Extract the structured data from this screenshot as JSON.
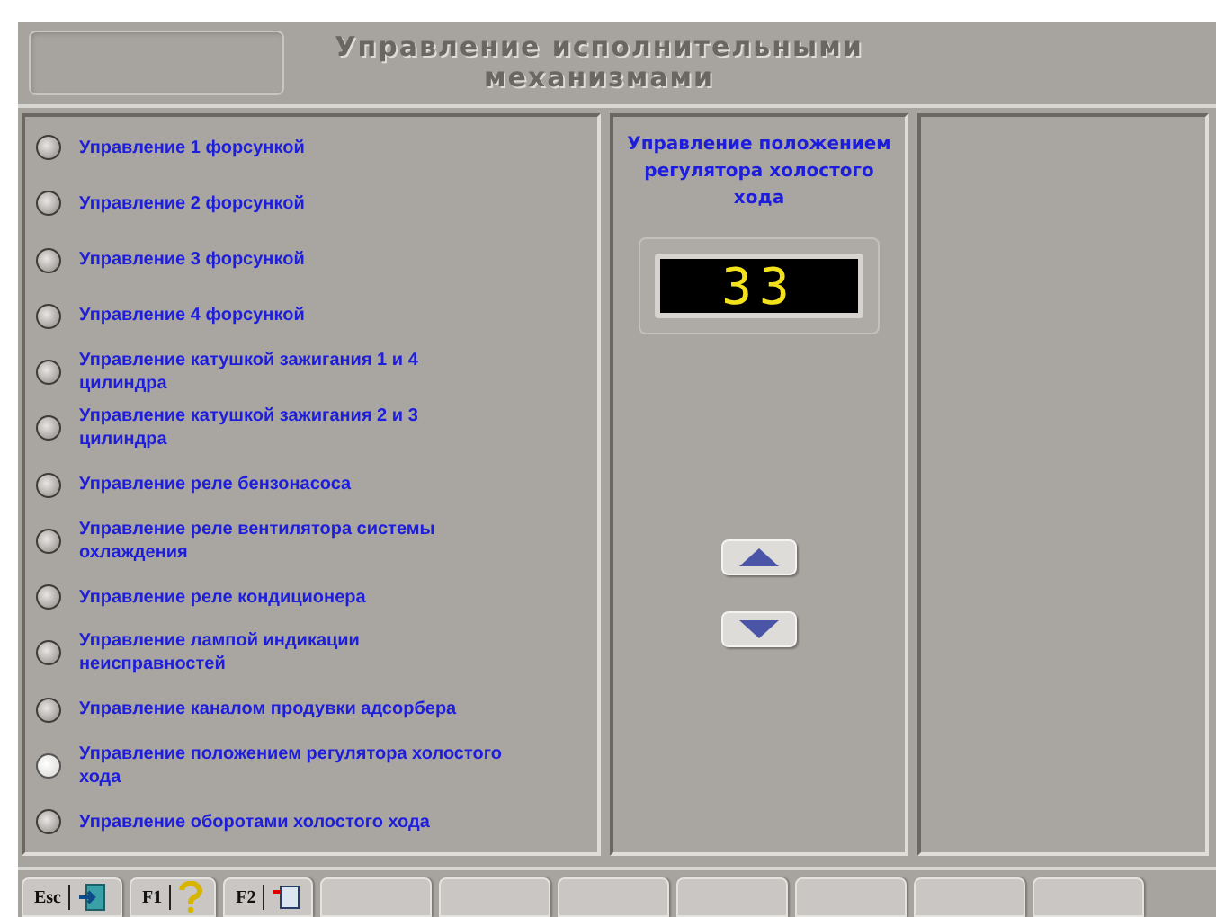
{
  "header": {
    "title": "Управление исполнительными механизмами"
  },
  "actuators": [
    {
      "label": "Управление 1 форсункой",
      "selected": false
    },
    {
      "label": "Управление 2 форсункой",
      "selected": false
    },
    {
      "label": "Управление 3 форсункой",
      "selected": false
    },
    {
      "label": "Управление 4 форсункой",
      "selected": false
    },
    {
      "label": "Управление катушкой зажигания 1 и 4 цилиндра",
      "selected": false
    },
    {
      "label": "Управление катушкой зажигания 2 и 3 цилиндра",
      "selected": false
    },
    {
      "label": "Управление реле бензонасоса",
      "selected": false
    },
    {
      "label": "Управление реле вентилятора системы охлаждения",
      "selected": false
    },
    {
      "label": "Управление реле кондиционера",
      "selected": false
    },
    {
      "label": "Управление лампой индикации неисправностей",
      "selected": false
    },
    {
      "label": "Управление каналом продувки адсорбера",
      "selected": false
    },
    {
      "label": "Управление положением регулятора холостого хода",
      "selected": true
    },
    {
      "label": "Управление оборотами холостого хода",
      "selected": false
    }
  ],
  "control": {
    "title": "Управление положением регулятора холостого хода",
    "display": "33"
  },
  "function_keys": [
    {
      "label": "Esc",
      "kind": "exit"
    },
    {
      "label": "F1",
      "kind": "help"
    },
    {
      "label": "F2",
      "kind": "window"
    },
    {
      "kind": "blank"
    },
    {
      "kind": "blank"
    },
    {
      "kind": "blank"
    },
    {
      "kind": "blank"
    },
    {
      "kind": "blank"
    },
    {
      "kind": "blank"
    },
    {
      "kind": "blank"
    }
  ]
}
